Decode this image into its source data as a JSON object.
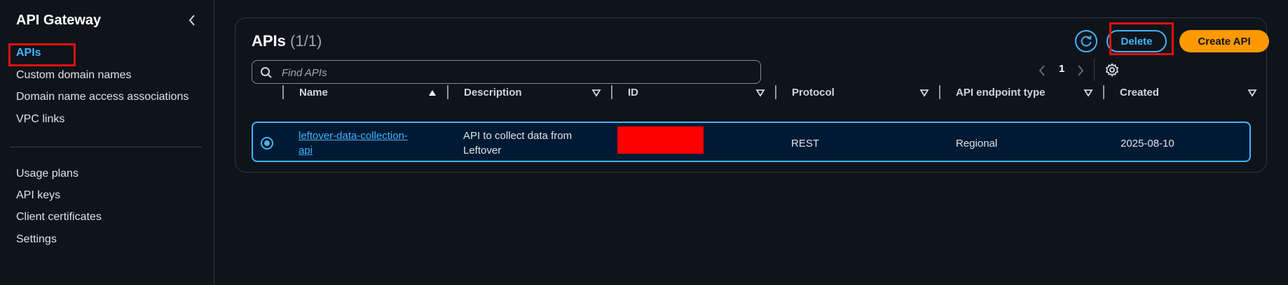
{
  "sidebar": {
    "title": "API Gateway",
    "items": [
      {
        "label": "APIs",
        "active": true
      },
      {
        "label": "Custom domain names"
      },
      {
        "label": "Domain name access associations"
      },
      {
        "label": "VPC links"
      },
      {
        "label": "Usage plans"
      },
      {
        "label": "API keys"
      },
      {
        "label": "Client certificates"
      },
      {
        "label": "Settings"
      }
    ]
  },
  "panel": {
    "title": "APIs",
    "count": "(1/1)",
    "delete_label": "Delete",
    "create_label": "Create API",
    "search_placeholder": "Find APIs",
    "page": "1"
  },
  "table": {
    "columns": [
      "Name",
      "Description",
      "ID",
      "Protocol",
      "API endpoint type",
      "Created"
    ],
    "rows": [
      {
        "name_line1": "leftover-data-collection-",
        "name_line2": "api",
        "description_line1": "API to collect data from",
        "description_line2": "Leftover",
        "id": "",
        "protocol": "REST",
        "endpoint_type": "Regional",
        "created": "2025-08-10"
      }
    ]
  },
  "colors": {
    "accent": "#42b4ff",
    "primary_button": "#ff9900",
    "background": "#0f141a",
    "highlight_box": "#e01010"
  },
  "icons": [
    "chevron-left-icon",
    "refresh-icon",
    "search-icon",
    "chevron-left-icon",
    "chevron-right-icon",
    "gear-icon",
    "sort-ascending-icon",
    "sort-descending-icon"
  ]
}
